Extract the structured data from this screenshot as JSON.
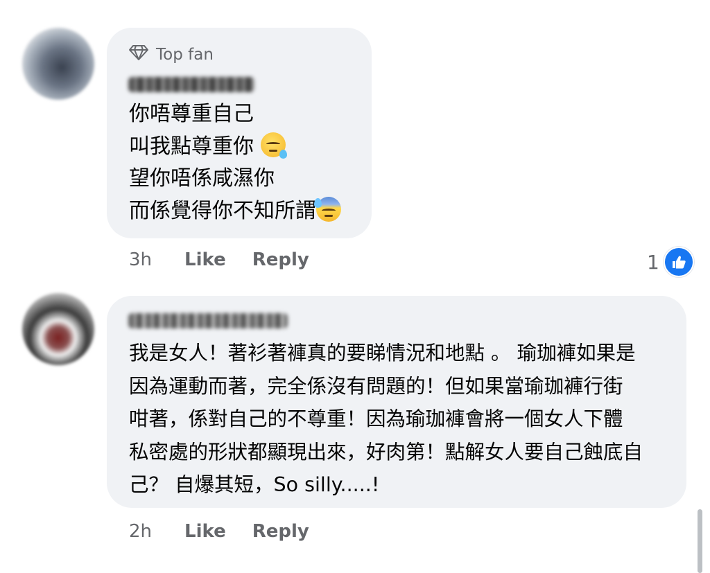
{
  "comments": [
    {
      "badge": "Top fan",
      "author": "Aaron Wood",
      "lines": [
        "你唔尊重自己",
        "叫我點尊重你",
        "望你唔係咸濕你",
        "而係覺得你不知所謂"
      ],
      "time": "3h",
      "like_label": "Like",
      "reply_label": "Reply",
      "reaction_count": "1"
    },
    {
      "author": "Fion Bartonella",
      "lines": [
        "我是女人！著衫著褲真的要睇情況和地點 。 瑜珈褲如果是",
        "因為運動而著，完全係沒有問題的！但如果當瑜珈褲行街",
        "咁著，係對自己的不尊重！因為瑜珈褲會將一個女人下體",
        "私密處的形狀都顯現出來，好肉第！點解女人要自己蝕底自",
        "己？ 自爆其短，So silly.....!"
      ],
      "time": "2h",
      "like_label": "Like",
      "reply_label": "Reply"
    }
  ],
  "icons": {
    "badge": "diamond-icon",
    "reaction": "thumbs-up-icon",
    "emoji_1": "sleepy-face-emoji",
    "emoji_2": "downcast-sweat-face-emoji"
  },
  "colors": {
    "bubble": "#f0f2f5",
    "secondary_text": "#65676b",
    "like_blue": "#1877f2"
  }
}
